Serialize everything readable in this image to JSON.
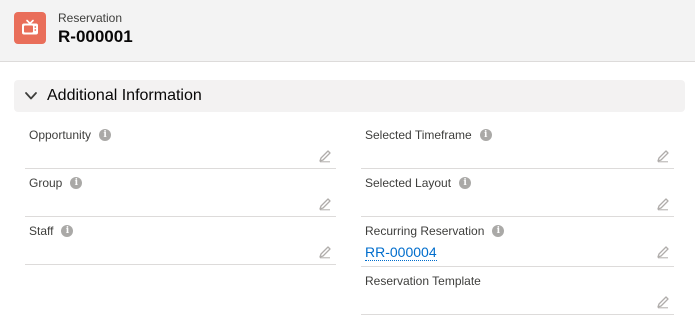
{
  "header": {
    "object_label": "Reservation",
    "record_name": "R-000001",
    "icon": "tv-icon",
    "icon_color": "#e96e5a"
  },
  "section": {
    "title": "Additional Information",
    "collapse_icon": "chevron-down-icon"
  },
  "fields": {
    "opportunity": {
      "label": "Opportunity",
      "value": ""
    },
    "group": {
      "label": "Group",
      "value": ""
    },
    "staff": {
      "label": "Staff",
      "value": ""
    },
    "selected_timeframe": {
      "label": "Selected Timeframe",
      "value": ""
    },
    "selected_layout": {
      "label": "Selected Layout",
      "value": ""
    },
    "recurring_reservation": {
      "label": "Recurring Reservation",
      "value": "RR-000004"
    },
    "reservation_template": {
      "label": "Reservation Template",
      "value": ""
    }
  },
  "colors": {
    "link": "#006dcc",
    "header_bg": "#f3f3f3",
    "section_bg": "#f3f2f2",
    "divider": "#dddbda"
  }
}
